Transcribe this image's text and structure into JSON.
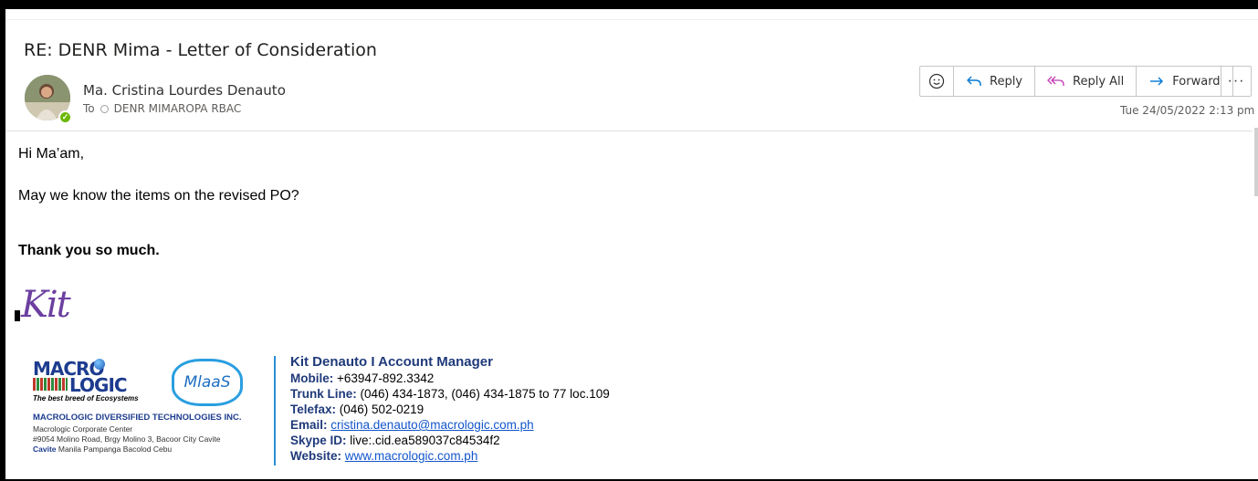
{
  "email": {
    "subject": "RE: DENR Mima - Letter of Consideration",
    "sender": "Ma. Cristina Lourdes Denauto",
    "to_label": "To",
    "recipient": "DENR MIMAROPA RBAC",
    "timestamp": "Tue 24/05/2022 2:13 pm"
  },
  "actions": {
    "reply": "Reply",
    "reply_all": "Reply All",
    "forward": "Forward",
    "more": "···"
  },
  "icons": {
    "emoji": "smiley-icon",
    "reply": "reply-arrow-icon",
    "reply_all": "reply-all-arrow-icon",
    "forward": "forward-arrow-icon",
    "more": "more-options-icon",
    "presence": "presence-available-icon"
  },
  "colors": {
    "reply_icon": "#0078d4",
    "reply_all_icon": "#c239b3",
    "forward_icon": "#0078d4",
    "presence": "#6bb700",
    "signature_accent": "#1f3a7a",
    "link": "#1155cc"
  },
  "body": {
    "greeting": "Hi Ma’am,",
    "question": "May we know the items on the revised PO?",
    "thanks": "Thank you so much.",
    "handwritten": "Kit"
  },
  "logo": {
    "macro": "MACRO",
    "logic": "LOGIC",
    "tagline": "The best breed of Ecosystems",
    "mlaas": "MlaaS",
    "company": "MACROLOGIC DIVERSIFIED TECHNOLOGIES INC.",
    "address_line1": "Macrologic Corporate Center",
    "address_line2": "#9054 Molino Road, Brgy Molino 3, Bacoor City Cavite",
    "branches": "Cavite",
    "branches_rest": " Manila  Pampanga  Bacolod  Cebu"
  },
  "signature": {
    "name": "Kit Denauto I Account Manager",
    "mobile_label": "Mobile:",
    "mobile": " +63947-892.3342",
    "trunk_label": "Trunk Line:",
    "trunk": " (046) 434-1873, (046) 434-1875 to 77 loc.109",
    "telefax_label": "Telefax:",
    "telefax": " (046) 502-0219",
    "email_label": "Email:",
    "email": "cristina.denauto@macrologic.com.ph",
    "skype_label": "Skype ID:",
    "skype": " live:.cid.ea589037c84534f2",
    "website_label": "Website:",
    "website": "www.macrologic.com.ph"
  }
}
